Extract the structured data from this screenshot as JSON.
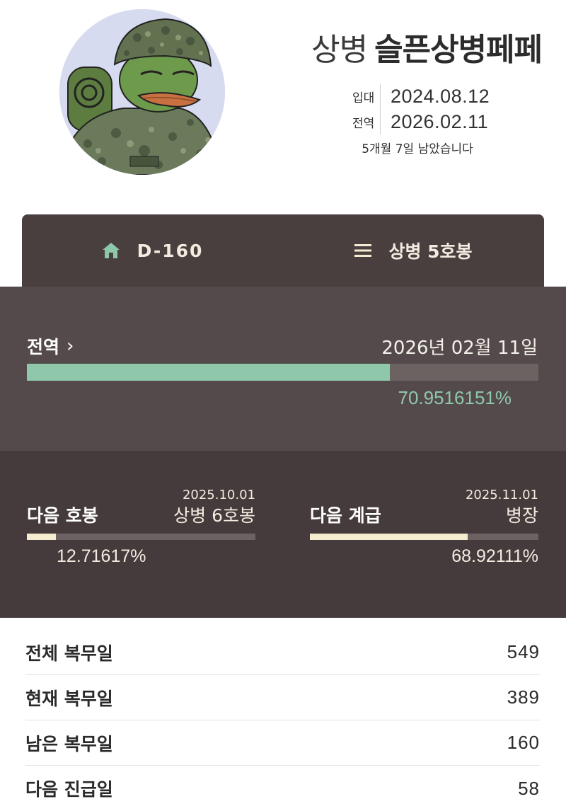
{
  "profile": {
    "rank": "상병",
    "nickname": "슬픈상병페페",
    "enlist_label": "입대",
    "enlist_date": "2024.08.12",
    "discharge_label": "전역",
    "discharge_date": "2026.02.11",
    "remaining_text": "5개월 7일 남았습니다"
  },
  "tabs": [
    {
      "label": "D-160",
      "icon": "home-icon"
    },
    {
      "label": "상병 5호봉",
      "icon": "menu-icon"
    }
  ],
  "discharge": {
    "title": "전역",
    "date": "2026년 02월 11일",
    "percent_text": "70.9516151%",
    "percent": 70.9516151
  },
  "next_step": {
    "title": "다음 호봉",
    "date": "2025.10.01",
    "target": "상병 6호봉",
    "percent_text": "12.71617%",
    "percent": 12.71617
  },
  "next_rank": {
    "title": "다음 계급",
    "date": "2025.11.01",
    "target": "병장",
    "percent_text": "68.92111%",
    "percent": 68.92111
  },
  "stats": [
    {
      "label": "전체 복무일",
      "value": "549"
    },
    {
      "label": "현재 복무일",
      "value": "389"
    },
    {
      "label": "남은 복무일",
      "value": "160"
    },
    {
      "label": "다음 진급일",
      "value": "58"
    }
  ],
  "colors": {
    "tab_bg": "#4a3f3f",
    "discharge_bg": "#544a4b",
    "next_bg": "#463b3c",
    "accent_green": "#8fc7ab",
    "accent_cream": "#f4ebd0"
  }
}
